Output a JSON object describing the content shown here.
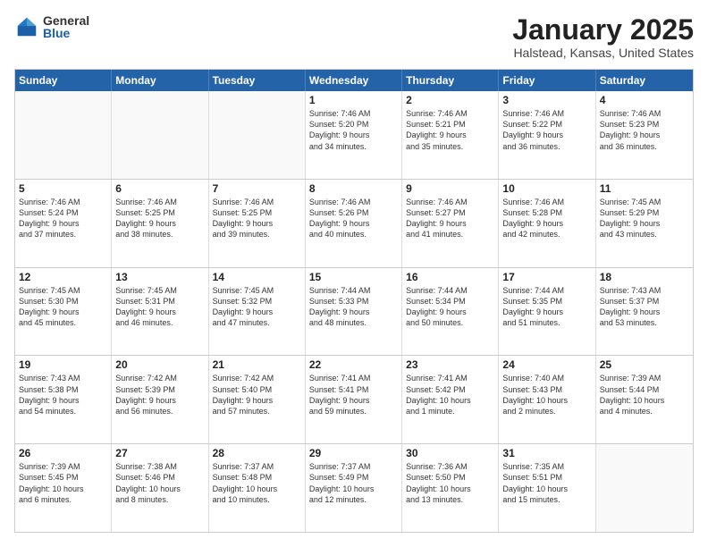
{
  "logo": {
    "general": "General",
    "blue": "Blue"
  },
  "title": "January 2025",
  "subtitle": "Halstead, Kansas, United States",
  "days": [
    "Sunday",
    "Monday",
    "Tuesday",
    "Wednesday",
    "Thursday",
    "Friday",
    "Saturday"
  ],
  "weeks": [
    [
      {
        "day": "",
        "info": ""
      },
      {
        "day": "",
        "info": ""
      },
      {
        "day": "",
        "info": ""
      },
      {
        "day": "1",
        "info": "Sunrise: 7:46 AM\nSunset: 5:20 PM\nDaylight: 9 hours\nand 34 minutes."
      },
      {
        "day": "2",
        "info": "Sunrise: 7:46 AM\nSunset: 5:21 PM\nDaylight: 9 hours\nand 35 minutes."
      },
      {
        "day": "3",
        "info": "Sunrise: 7:46 AM\nSunset: 5:22 PM\nDaylight: 9 hours\nand 36 minutes."
      },
      {
        "day": "4",
        "info": "Sunrise: 7:46 AM\nSunset: 5:23 PM\nDaylight: 9 hours\nand 36 minutes."
      }
    ],
    [
      {
        "day": "5",
        "info": "Sunrise: 7:46 AM\nSunset: 5:24 PM\nDaylight: 9 hours\nand 37 minutes."
      },
      {
        "day": "6",
        "info": "Sunrise: 7:46 AM\nSunset: 5:25 PM\nDaylight: 9 hours\nand 38 minutes."
      },
      {
        "day": "7",
        "info": "Sunrise: 7:46 AM\nSunset: 5:25 PM\nDaylight: 9 hours\nand 39 minutes."
      },
      {
        "day": "8",
        "info": "Sunrise: 7:46 AM\nSunset: 5:26 PM\nDaylight: 9 hours\nand 40 minutes."
      },
      {
        "day": "9",
        "info": "Sunrise: 7:46 AM\nSunset: 5:27 PM\nDaylight: 9 hours\nand 41 minutes."
      },
      {
        "day": "10",
        "info": "Sunrise: 7:46 AM\nSunset: 5:28 PM\nDaylight: 9 hours\nand 42 minutes."
      },
      {
        "day": "11",
        "info": "Sunrise: 7:45 AM\nSunset: 5:29 PM\nDaylight: 9 hours\nand 43 minutes."
      }
    ],
    [
      {
        "day": "12",
        "info": "Sunrise: 7:45 AM\nSunset: 5:30 PM\nDaylight: 9 hours\nand 45 minutes."
      },
      {
        "day": "13",
        "info": "Sunrise: 7:45 AM\nSunset: 5:31 PM\nDaylight: 9 hours\nand 46 minutes."
      },
      {
        "day": "14",
        "info": "Sunrise: 7:45 AM\nSunset: 5:32 PM\nDaylight: 9 hours\nand 47 minutes."
      },
      {
        "day": "15",
        "info": "Sunrise: 7:44 AM\nSunset: 5:33 PM\nDaylight: 9 hours\nand 48 minutes."
      },
      {
        "day": "16",
        "info": "Sunrise: 7:44 AM\nSunset: 5:34 PM\nDaylight: 9 hours\nand 50 minutes."
      },
      {
        "day": "17",
        "info": "Sunrise: 7:44 AM\nSunset: 5:35 PM\nDaylight: 9 hours\nand 51 minutes."
      },
      {
        "day": "18",
        "info": "Sunrise: 7:43 AM\nSunset: 5:37 PM\nDaylight: 9 hours\nand 53 minutes."
      }
    ],
    [
      {
        "day": "19",
        "info": "Sunrise: 7:43 AM\nSunset: 5:38 PM\nDaylight: 9 hours\nand 54 minutes."
      },
      {
        "day": "20",
        "info": "Sunrise: 7:42 AM\nSunset: 5:39 PM\nDaylight: 9 hours\nand 56 minutes."
      },
      {
        "day": "21",
        "info": "Sunrise: 7:42 AM\nSunset: 5:40 PM\nDaylight: 9 hours\nand 57 minutes."
      },
      {
        "day": "22",
        "info": "Sunrise: 7:41 AM\nSunset: 5:41 PM\nDaylight: 9 hours\nand 59 minutes."
      },
      {
        "day": "23",
        "info": "Sunrise: 7:41 AM\nSunset: 5:42 PM\nDaylight: 10 hours\nand 1 minute."
      },
      {
        "day": "24",
        "info": "Sunrise: 7:40 AM\nSunset: 5:43 PM\nDaylight: 10 hours\nand 2 minutes."
      },
      {
        "day": "25",
        "info": "Sunrise: 7:39 AM\nSunset: 5:44 PM\nDaylight: 10 hours\nand 4 minutes."
      }
    ],
    [
      {
        "day": "26",
        "info": "Sunrise: 7:39 AM\nSunset: 5:45 PM\nDaylight: 10 hours\nand 6 minutes."
      },
      {
        "day": "27",
        "info": "Sunrise: 7:38 AM\nSunset: 5:46 PM\nDaylight: 10 hours\nand 8 minutes."
      },
      {
        "day": "28",
        "info": "Sunrise: 7:37 AM\nSunset: 5:48 PM\nDaylight: 10 hours\nand 10 minutes."
      },
      {
        "day": "29",
        "info": "Sunrise: 7:37 AM\nSunset: 5:49 PM\nDaylight: 10 hours\nand 12 minutes."
      },
      {
        "day": "30",
        "info": "Sunrise: 7:36 AM\nSunset: 5:50 PM\nDaylight: 10 hours\nand 13 minutes."
      },
      {
        "day": "31",
        "info": "Sunrise: 7:35 AM\nSunset: 5:51 PM\nDaylight: 10 hours\nand 15 minutes."
      },
      {
        "day": "",
        "info": ""
      }
    ]
  ]
}
